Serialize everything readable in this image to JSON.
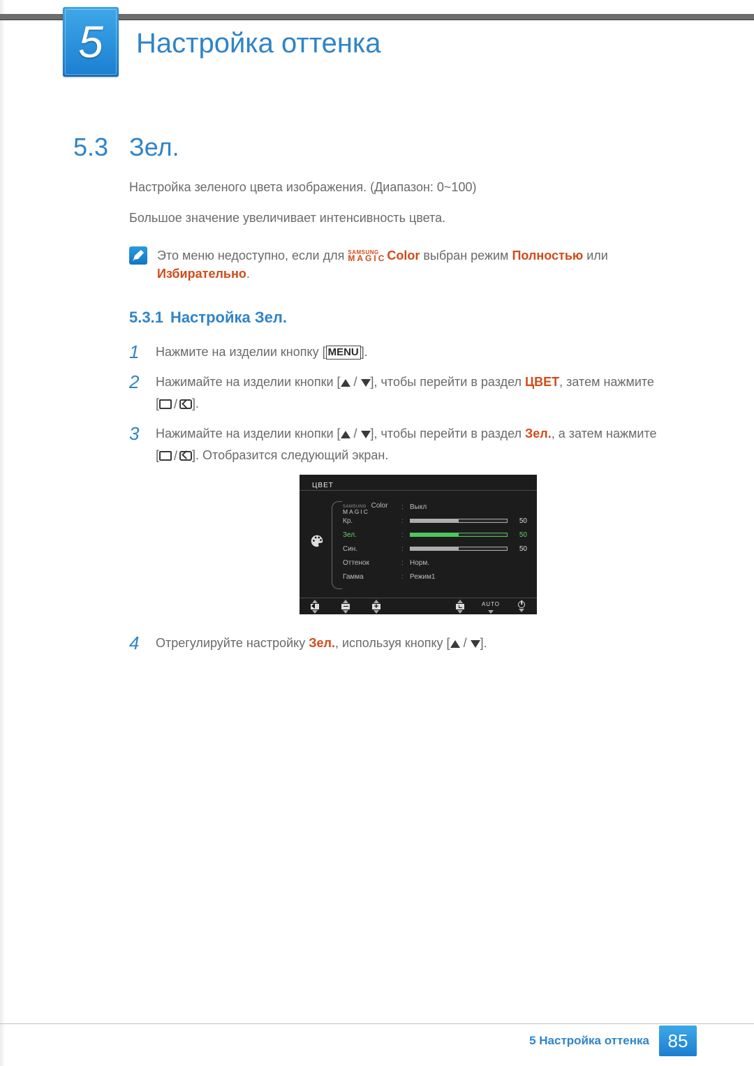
{
  "chapter": {
    "number": "5",
    "title": "Настройка оттенка"
  },
  "section": {
    "number": "5.3",
    "title": "Зел."
  },
  "paragraphs": {
    "p1": "Настройка зеленого цвета изображения. (Диапазон: 0~100)",
    "p2": "Большое значение увеличивает интенсивность цвета."
  },
  "note": {
    "prefix": "Это меню недоступно, если для ",
    "magic_top": "SAMSUNG",
    "magic_bottom": "MAGIC",
    "magic_suffix": "Color",
    "mid": " выбран режим ",
    "opt1": "Полностью",
    "or": " или ",
    "opt2": "Избирательно",
    "end": "."
  },
  "subsection": {
    "number": "5.3.1",
    "title": "Настройка Зел."
  },
  "steps": {
    "s1": {
      "num": "1",
      "text_a": "Нажмите на изделии кнопку [",
      "menu": "MENU",
      "text_b": "]."
    },
    "s2": {
      "num": "2",
      "text_a": "Нажимайте на изделии кнопки [",
      "text_b": "], чтобы перейти в раздел ",
      "cvet": "ЦВЕТ",
      "text_c": ", затем нажмите",
      "text_d": "[",
      "text_e": "]."
    },
    "s3": {
      "num": "3",
      "text_a": "Нажимайте на изделии кнопки [",
      "text_b": "], чтобы перейти в раздел ",
      "zel": "Зел.",
      "text_c": ", а затем нажмите",
      "text_d": "[",
      "text_e1": "]. Отобразится следующий экран."
    },
    "s4": {
      "num": "4",
      "text_a": "Отрегулируйте настройку ",
      "zel": "Зел.",
      "text_b": ", используя кнопку [",
      "text_c": "]."
    }
  },
  "osd": {
    "title": "ЦВЕТ",
    "rows": {
      "magic_top": "SAMSUNG",
      "magic_bottom": "MAGIC",
      "magic_label": " Color",
      "magic_value": "Выкл",
      "kr_label": "Кр.",
      "kr_value": "50",
      "zel_label": "Зел.",
      "zel_value": "50",
      "sin_label": "Син.",
      "sin_value": "50",
      "ott_label": "Оттенок",
      "ott_value": "Норм.",
      "gam_label": "Гамма",
      "gam_value": "Режим1"
    },
    "auto": "AUTO"
  },
  "footer": {
    "text": "5 Настройка оттенка",
    "page": "85"
  }
}
